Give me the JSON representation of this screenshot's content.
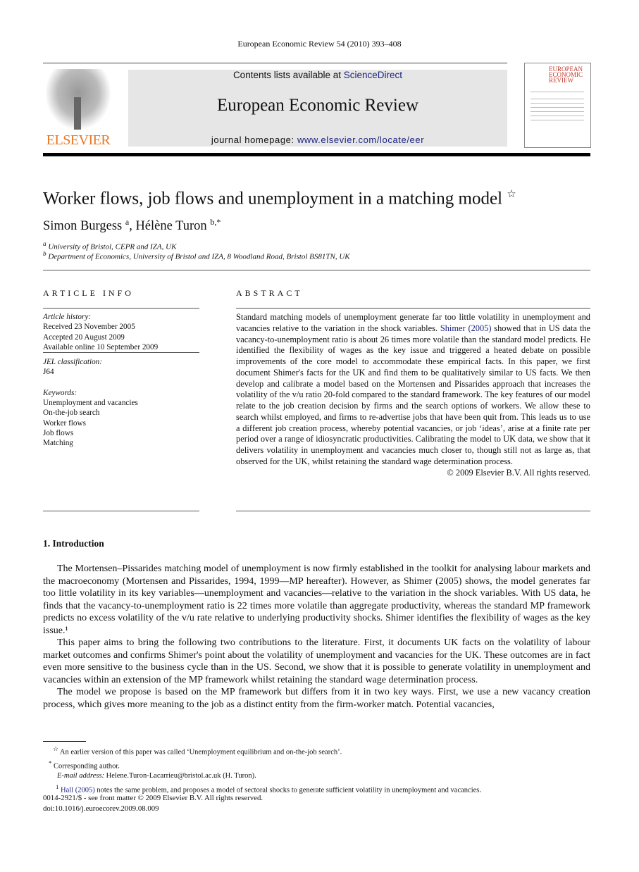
{
  "running_head": "European Economic Review 54 (2010) 393–408",
  "publisher_logo": "ELSEVIER",
  "banner": {
    "contents_prefix": "Contents lists available at ",
    "contents_link": "ScienceDirect",
    "journal_title": "European Economic Review",
    "homepage_prefix": "journal homepage: ",
    "homepage_link": "www.elsevier.com/locate/eer"
  },
  "cover_thumbnail_title": "EUROPEAN ECONOMIC REVIEW",
  "title": "Worker flows, job flows and unemployment in a matching model",
  "title_mark": "☆",
  "authors": [
    {
      "name": "Simon Burgess",
      "sup": "a"
    },
    {
      "name": "Hélène Turon",
      "sup": "b,*"
    }
  ],
  "author_sep": ", ",
  "affiliations": [
    {
      "sup": "a",
      "text": "University of Bristol, CEPR and IZA, UK"
    },
    {
      "sup": "b",
      "text": "Department of Economics, University of Bristol and IZA, 8 Woodland Road, Bristol BS81TN, UK"
    }
  ],
  "article_info": {
    "heading": "ARTICLE INFO",
    "history_label": "Article history:",
    "history": [
      "Received 23 November 2005",
      "Accepted 20 August 2009",
      "Available online 10 September 2009"
    ],
    "jel_label": "JEL classification:",
    "jel": "J64",
    "keywords_label": "Keywords:",
    "keywords": [
      "Unemployment and vacancies",
      "On-the-job search",
      "Worker flows",
      "Job flows",
      "Matching"
    ]
  },
  "abstract": {
    "heading": "ABSTRACT",
    "part1": "Standard matching models of unemployment generate far too little volatility in unemployment and vacancies relative to the variation in the shock variables. ",
    "cite": "Shimer (2005)",
    "part2": " showed that in US data the vacancy-to-unemployment ratio is about 26 times more volatile than the standard model predicts. He identified the flexibility of wages as the key issue and triggered a heated debate on possible improvements of the core model to accommodate these empirical facts. In this paper, we first document Shimer's facts for the UK and find them to be qualitatively similar to US facts. We then develop and calibrate a model based on the Mortensen and Pissarides approach that increases the volatility of the v/u ratio 20-fold compared to the standard framework. The key features of our model relate to the job creation decision by firms and the search options of workers. We allow these to search whilst employed, and firms to re-advertise jobs that have been quit from. This leads us to use a different job creation process, whereby potential vacancies, or job ‘ideas’, arise at a finite rate per period over a range of idiosyncratic productivities. Calibrating the model to UK data, we show that it delivers volatility in unemployment and vacancies much closer to, though still not as large as, that observed for the UK, whilst retaining the standard wage determination process.",
    "copyright": "© 2009 Elsevier B.V. All rights reserved."
  },
  "intro": {
    "heading": "1.   Introduction",
    "paragraphs": [
      "The Mortensen–Pissarides matching model of unemployment is now firmly established in the toolkit for analysing labour markets and the macroeconomy (Mortensen and Pissarides, 1994, 1999—MP hereafter). However, as Shimer (2005) shows, the model generates far too little volatility in its key variables—unemployment and vacancies—relative to the variation in the shock variables. With US data, he finds that the vacancy-to-unemployment ratio is 22 times more volatile than aggregate productivity, whereas the standard MP framework predicts no excess volatility of the v/u rate relative to underlying productivity shocks. Shimer identifies the flexibility of wages as the key issue.¹",
      "This paper aims to bring the following two contributions to the literature. First, it documents UK facts on the volatility of labour market outcomes and confirms Shimer's point about the volatility of unemployment and vacancies for the UK. These outcomes are in fact even more sensitive to the business cycle than in the US. Second, we show that it is possible to generate volatility in unemployment and vacancies within an extension of the MP framework whilst retaining the standard wage determination process.",
      "The model we propose is based on the MP framework but differs from it in two key ways. First, we use a new vacancy creation process, which gives more meaning to the job as a distinct entity from the firm-worker match. Potential vacancies,"
    ]
  },
  "footnotes": {
    "star": "☆",
    "star_text": "An earlier version of this paper was called ‘Unemployment equilibrium and on-the-job search’.",
    "corr_mark": "*",
    "corr_text": "Corresponding author.",
    "email_label": "E-mail address:",
    "email_text": "Helene.Turon-Lacarrieu@bristol.ac.uk (H. Turon).",
    "fn1_mark": "1",
    "fn1_cite": "Hall (2005)",
    "fn1_text": " notes the same problem, and proposes a model of sectoral shocks to generate sufficient volatility in unemployment and vacancies."
  },
  "bottom": {
    "issn": "0014-2921/$ - see front matter © 2009 Elsevier B.V. All rights reserved.",
    "doi": "doi:10.1016/j.euroecorev.2009.08.009"
  },
  "colors": {
    "link": "#1a237e",
    "elsevier_orange": "#e87722",
    "banner_gray": "#e6e6e6"
  }
}
